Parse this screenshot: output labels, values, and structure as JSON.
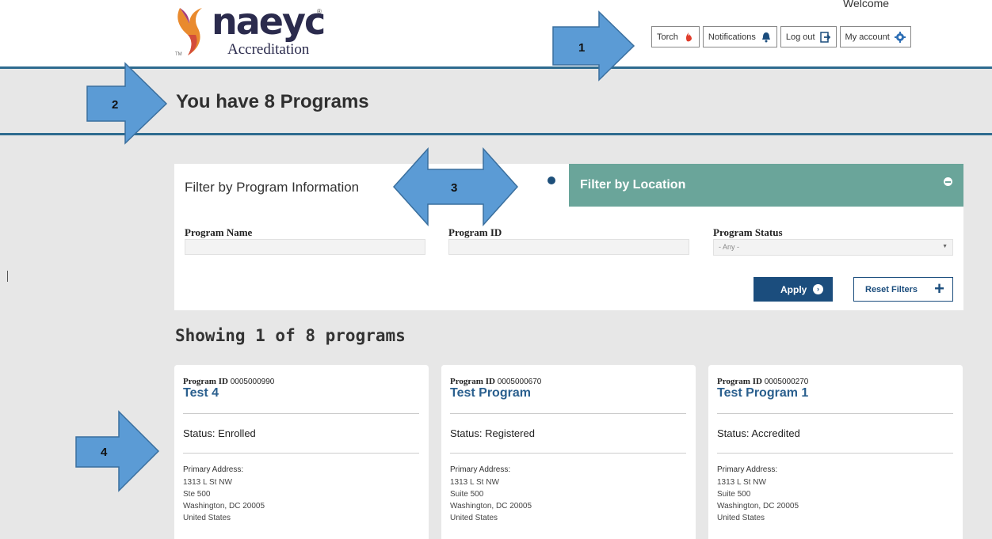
{
  "header": {
    "brand": "naeyc",
    "brand_reg": "®",
    "brand_sub": "Accreditation",
    "brand_tm": "TM",
    "welcome": "Welcome",
    "nav": [
      {
        "label": "Torch",
        "icon": "torch-flame-icon"
      },
      {
        "label": "Notifications",
        "icon": "bell-icon"
      },
      {
        "label": "Log out",
        "icon": "logout-icon"
      },
      {
        "label": "My account",
        "icon": "gear-icon"
      }
    ]
  },
  "banner": {
    "title": "You have 8 Programs"
  },
  "filter": {
    "tab_left": "Filter by Program Information",
    "tab_right": "Filter by Location",
    "fields": {
      "program_name": "Program Name",
      "program_id": "Program ID",
      "program_status": "Program Status",
      "status_value": "- Any -"
    },
    "apply_label": "Apply",
    "reset_label": "Reset Filters"
  },
  "results": {
    "showing": "Showing 1 of 8 programs"
  },
  "cards": [
    {
      "id_label": "Program ID",
      "id": "0005000990",
      "name": "Test 4",
      "status": "Status: Enrolled",
      "addr_label": "Primary Address:",
      "addr": [
        "1313 L St NW",
        "Ste 500",
        "Washington, DC 20005",
        "United States"
      ]
    },
    {
      "id_label": "Program ID",
      "id": "0005000670",
      "name": "Test Program",
      "status": "Status: Registered",
      "addr_label": "Primary Address:",
      "addr": [
        "1313 L St NW",
        "Suite 500",
        "Washington, DC 20005",
        "United States"
      ]
    },
    {
      "id_label": "Program ID",
      "id": "0005000270",
      "name": "Test Program 1",
      "status": "Status: Accredited",
      "addr_label": "Primary Address:",
      "addr": [
        "1313 L St NW",
        "Suite 500",
        "Washington, DC 20005",
        "United States"
      ]
    }
  ],
  "annotations": {
    "n1": "1",
    "n2": "2",
    "n3": "3",
    "n4": "4"
  },
  "colors": {
    "rule": "#2e6b8f",
    "tab_green": "#6aa59a",
    "primary_blue": "#1b4d7d",
    "arrow_fill": "#5b9bd5"
  }
}
